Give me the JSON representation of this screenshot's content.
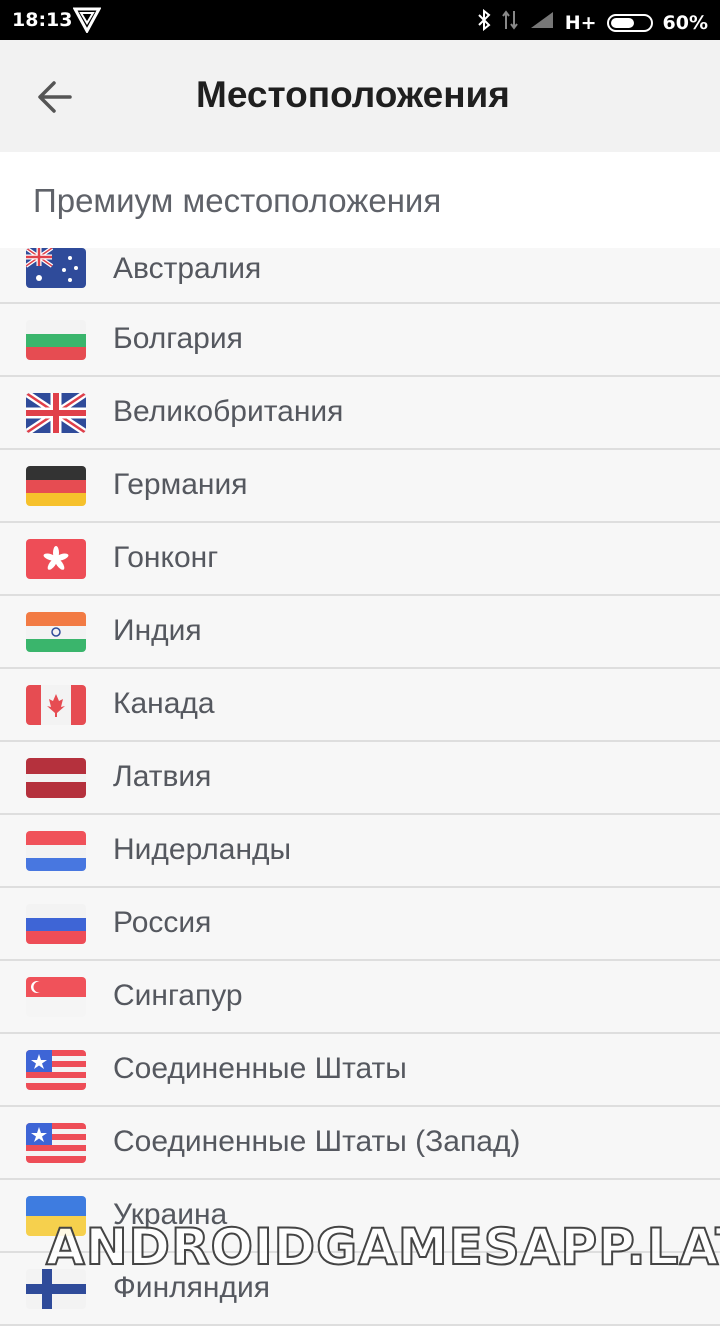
{
  "status_bar": {
    "time": "18:13",
    "network": "H+",
    "battery": "60%",
    "battery_level": 0.6
  },
  "app_bar": {
    "title": "Местоположения",
    "back_icon": "arrow-back-icon"
  },
  "section": {
    "title": "Премиум местоположения"
  },
  "locations": [
    {
      "label": "Австралия",
      "flag": "australia-flag-icon"
    },
    {
      "label": "Болгария",
      "flag": "bulgaria-flag-icon"
    },
    {
      "label": "Великобритания",
      "flag": "uk-flag-icon"
    },
    {
      "label": "Германия",
      "flag": "germany-flag-icon"
    },
    {
      "label": "Гонконг",
      "flag": "hong-kong-flag-icon"
    },
    {
      "label": "Индия",
      "flag": "india-flag-icon"
    },
    {
      "label": "Канада",
      "flag": "canada-flag-icon"
    },
    {
      "label": "Латвия",
      "flag": "latvia-flag-icon"
    },
    {
      "label": "Нидерланды",
      "flag": "netherlands-flag-icon"
    },
    {
      "label": "Россия",
      "flag": "russia-flag-icon"
    },
    {
      "label": "Сингапур",
      "flag": "singapore-flag-icon"
    },
    {
      "label": "Соединенные Штаты",
      "flag": "usa-flag-icon"
    },
    {
      "label": "Соединенные Штаты (Запад)",
      "flag": "usa-flag-icon"
    },
    {
      "label": "Украина",
      "flag": "ukraine-flag-icon"
    },
    {
      "label": "Финляндия",
      "flag": "finland-flag-icon"
    }
  ],
  "watermark": "ANDROIDGAMESAPP.LAT",
  "colors": {
    "text_primary": "#1f1f1f",
    "text_secondary": "#55585f",
    "divider": "#dedede"
  }
}
